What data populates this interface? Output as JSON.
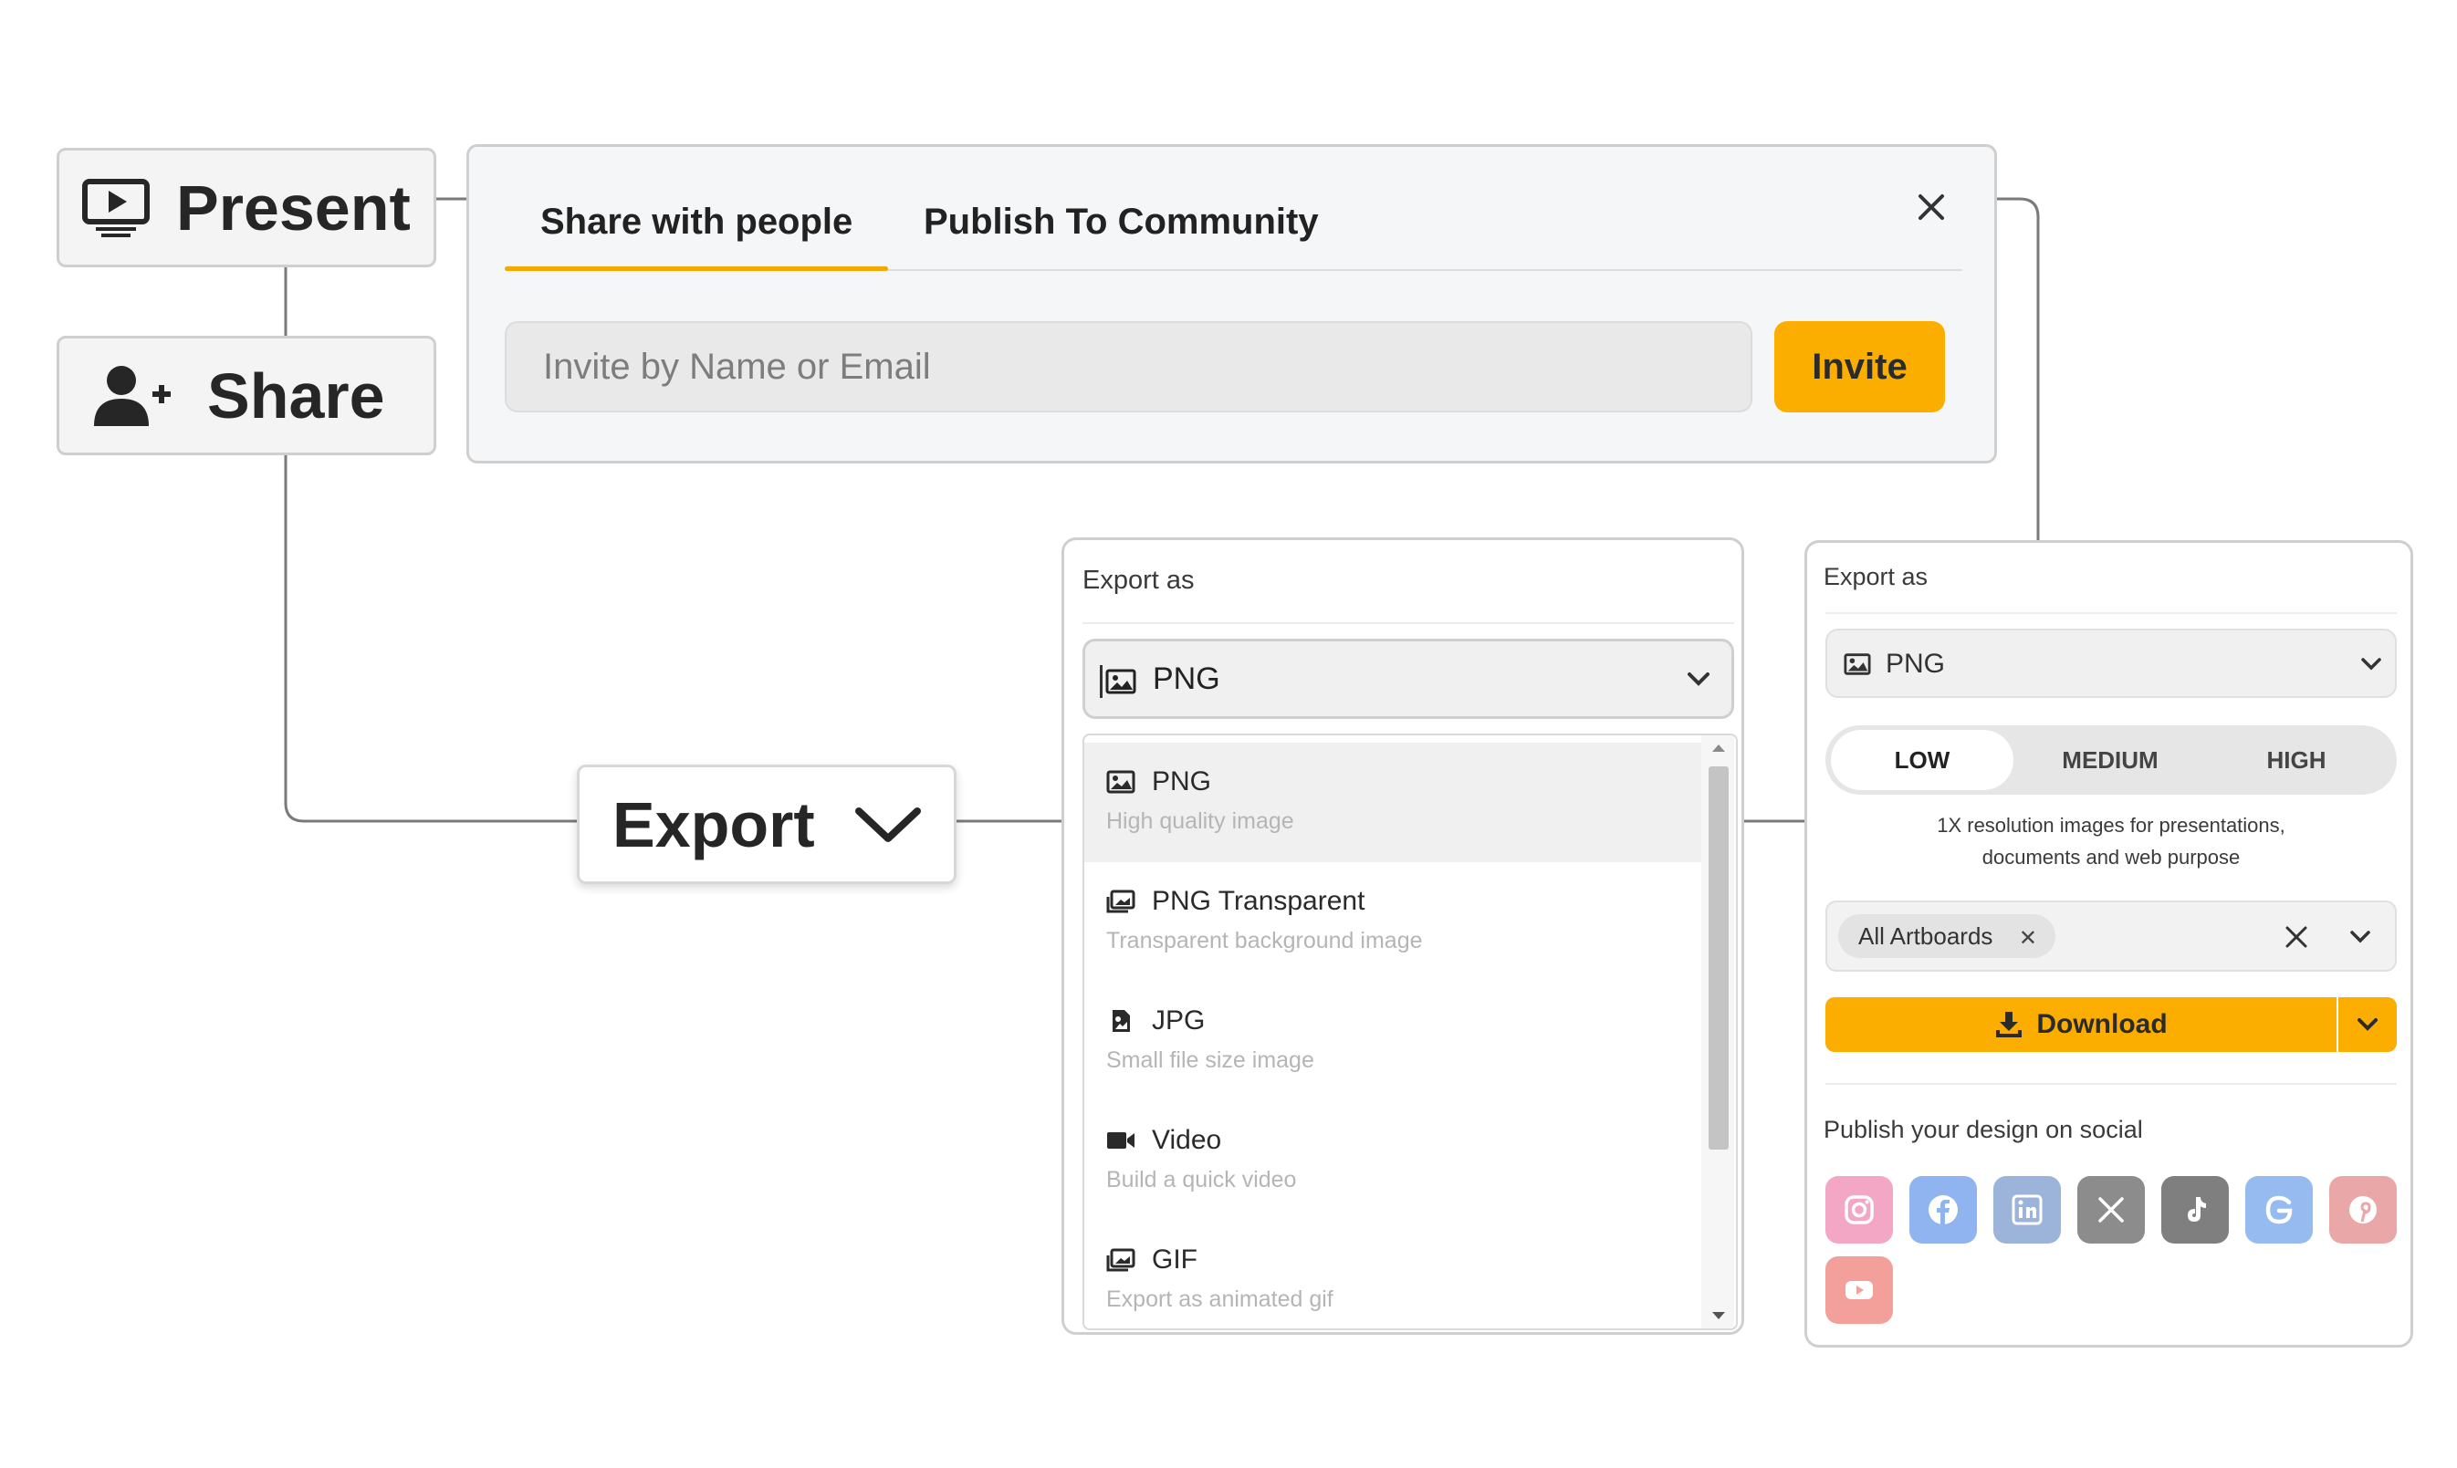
{
  "nav": {
    "present_label": "Present",
    "share_label": "Share",
    "export_label": "Export"
  },
  "share_dialog": {
    "tabs": [
      {
        "label": "Share with people",
        "active": true
      },
      {
        "label": "Publish To Community",
        "active": false
      }
    ],
    "invite_placeholder": "Invite by Name or Email",
    "invite_button": "Invite"
  },
  "export_dropdown": {
    "title": "Export as",
    "selected": "PNG",
    "options": [
      {
        "label": "PNG",
        "description": "High quality image",
        "icon": "image-icon"
      },
      {
        "label": "PNG Transparent",
        "description": "Transparent background image",
        "icon": "images-icon"
      },
      {
        "label": "JPG",
        "description": "Small file size image",
        "icon": "file-image-icon"
      },
      {
        "label": "Video",
        "description": "Build a quick video",
        "icon": "video-icon"
      },
      {
        "label": "GIF",
        "description": "Export as animated gif",
        "icon": "images-icon"
      }
    ]
  },
  "download_panel": {
    "title": "Export as",
    "selected_format": "PNG",
    "quality_options": [
      {
        "label": "LOW",
        "active": true
      },
      {
        "label": "MEDIUM",
        "active": false
      },
      {
        "label": "HIGH",
        "active": false
      }
    ],
    "quality_description_line1": "1X resolution images for presentations,",
    "quality_description_line2": "documents and web purpose",
    "artboard_chip": "All Artboards",
    "download_label": "Download",
    "social_heading": "Publish your design on social",
    "social_icons": [
      {
        "name": "instagram-icon",
        "color": "#f4a7c4"
      },
      {
        "name": "facebook-icon",
        "color": "#8fb4ef"
      },
      {
        "name": "linkedin-icon",
        "color": "#9cb4da"
      },
      {
        "name": "x-icon",
        "color": "#8c8c8c"
      },
      {
        "name": "tiktok-icon",
        "color": "#7f7f7f"
      },
      {
        "name": "google-icon",
        "color": "#95bbf0"
      },
      {
        "name": "pinterest-icon",
        "color": "#eaa7a7"
      },
      {
        "name": "youtube-icon",
        "color": "#f3a09a"
      }
    ]
  },
  "colors": {
    "accent": "#fcae00",
    "border": "#cfcfcf"
  }
}
